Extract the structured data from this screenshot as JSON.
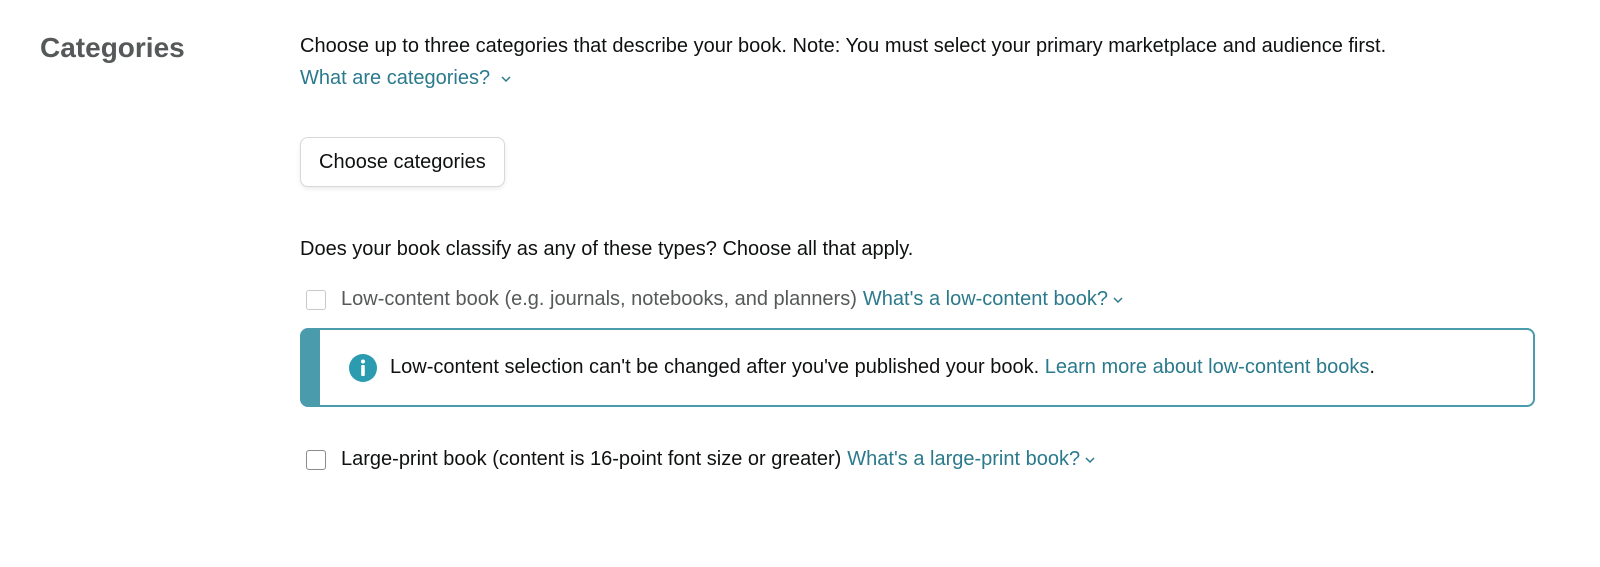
{
  "section": {
    "title": "Categories"
  },
  "intro": {
    "text": "Choose up to three categories that describe your book. Note: You must select your primary marketplace and audience first.",
    "help_link": "What are categories?"
  },
  "choose_button": {
    "label": "Choose categories"
  },
  "types": {
    "question": "Does your book classify as any of these types? Choose all that apply.",
    "low_content": {
      "label": "Low-content book (e.g. journals, notebooks, and planners)",
      "help_link": "What's a low-content book?",
      "checked": false,
      "disabled": true
    },
    "alert": {
      "text": "Low-content selection can't be changed after you've published your book.",
      "link": "Learn more about low-content books",
      "suffix": "."
    },
    "large_print": {
      "label": "Large-print book (content is 16-point font size or greater)",
      "help_link": "What's a large-print book?",
      "checked": false
    }
  },
  "colors": {
    "link": "#2a7a8c",
    "alert_accent": "#4a9bac",
    "title_gray": "#565959",
    "text": "#0f1111"
  },
  "icons": {
    "info": "info-icon",
    "chevron": "chevron-down-icon"
  }
}
